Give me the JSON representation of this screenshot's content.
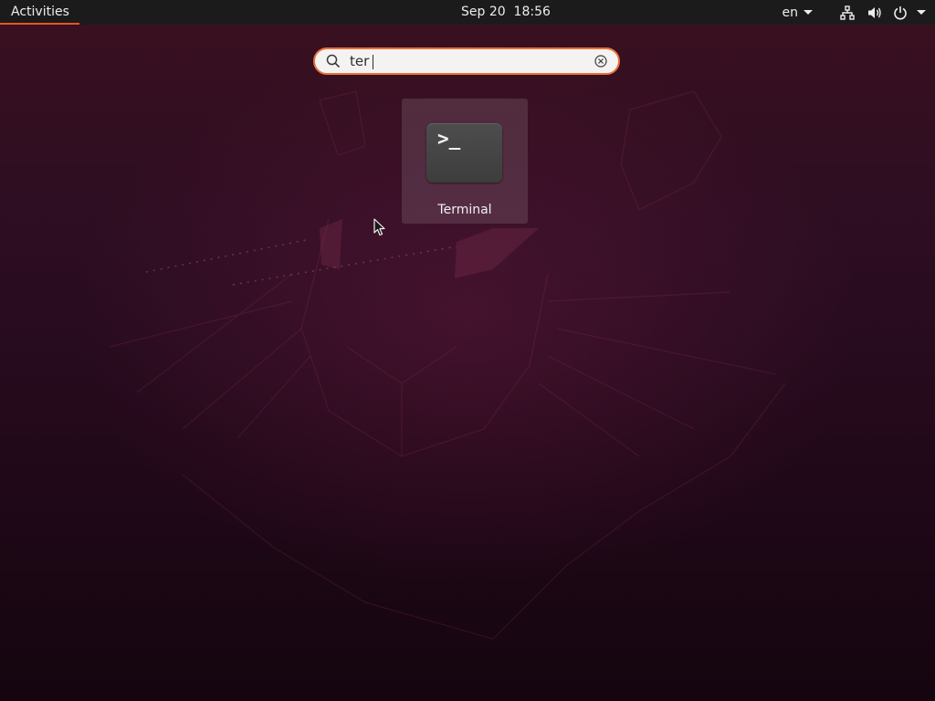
{
  "topbar": {
    "activities_label": "Activities",
    "clock": "Sep 20  18:56",
    "language": "en",
    "icons": [
      "network-icon",
      "volume-icon",
      "power-icon",
      "chevron-down-icon"
    ]
  },
  "search": {
    "value": "ter",
    "icon": "search-icon",
    "clear_icon": "clear-icon"
  },
  "results": [
    {
      "label": "Terminal",
      "icon": "terminal-icon",
      "glyph": ">_"
    }
  ],
  "colors": {
    "accent": "#e95420",
    "topbar_bg": "#1b1b1b",
    "search_border": "#e9703a"
  }
}
